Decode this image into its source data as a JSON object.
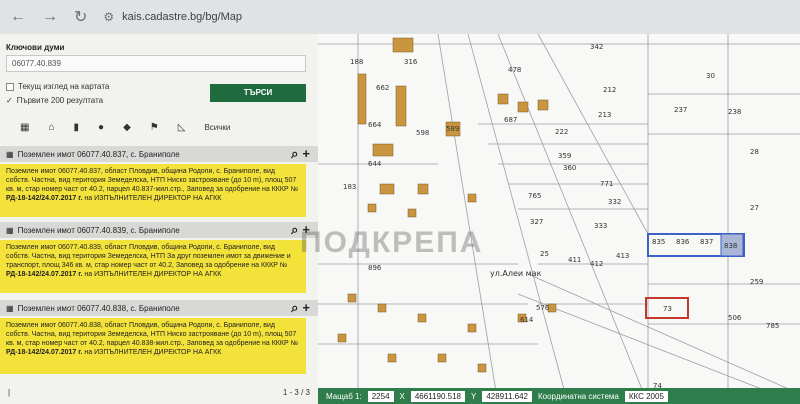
{
  "browser": {
    "back": "←",
    "forward": "→",
    "reload": "↻",
    "url": "kais.cadastre.bg/bg/Map"
  },
  "sidebar": {
    "keywords_label": "Ключови думи",
    "search_value": "06077.40.839",
    "current_view_label": "Текущ изглед на картата",
    "first200_label": "Първите 200 резултата",
    "search_button": "ТЪРСИ",
    "all_label": "Всички"
  },
  "results": [
    {
      "title": "Поземлен имот 06077.40.837, с. Браниполе",
      "line1": "Поземлен имот 06077.40.837, област Пловдив, община Родопи, с. Браниполе, вид собств. Частна, вид територия Земеделска, НТП Ниско застрояване (до 10 m), площ 507 кв. м, стар номер част от 40.2, парцел 40.837-жил.стр.,",
      "approval_prefix": "Заповед за одобрение на КККР №",
      "approval_num": "РД-18-142/24.07.2017 г.",
      "approval_suffix": "на ИЗПЪЛНИТЕЛЕН ДИРЕКТОР НА АГКК"
    },
    {
      "title": "Поземлен имот 06077.40.839, с. Браниполе",
      "line1": "Поземлен имот 06077.40.839, област Пловдив, община Родопи, с. Браниполе, вид собств. Частна, вид територия Земеделска, НТП За друг поземлен имот за движение и транспорт, площ 346 кв. м, стар номер част от 40.2,",
      "approval_prefix": "Заповед за одобрение на КККР №",
      "approval_num": "РД-18-142/24.07.2017 г.",
      "approval_suffix": "на ИЗПЪЛНИТЕЛЕН ДИРЕКТОР НА АГКК"
    },
    {
      "title": "Поземлен имот 06077.40.838, с. Браниполе",
      "line1": "Поземлен имот 06077.40.838, област Пловдив, община Родопи, с. Браниполе, вид собств. Частна, вид територия Земеделска, НТП Ниско застрояване (до 10 m), площ 507 кв. м, стар номер част от 40.2, парцел 40.838-жил.стр.,",
      "approval_prefix": "Заповед за одобрение на КККР №",
      "approval_num": "РД-18-142/24.07.2017 г.",
      "approval_suffix": "на ИЗПЪЛНИТЕЛЕН ДИРЕКТОР НА АГКК"
    }
  ],
  "pager": {
    "text": "1 - 3 / 3"
  },
  "map": {
    "parcel_labels": [
      "342",
      "478",
      "316",
      "188",
      "212",
      "662",
      "213",
      "664",
      "598",
      "222",
      "589",
      "359",
      "360",
      "765",
      "771",
      "332",
      "327",
      "183",
      "333",
      "644",
      "25",
      "411",
      "412",
      "413",
      "28",
      "27",
      "835",
      "836",
      "837",
      "838",
      "259",
      "30",
      "237",
      "238",
      "73",
      "506",
      "785",
      "614",
      "576",
      "74",
      "896",
      "687"
    ],
    "street_label": "ул.Алеи мак"
  },
  "watermark": "ПОДКРЕПА",
  "bottom": {
    "scale_label": "Мащаб 1:",
    "scale_value": "2254",
    "x_value": "4661190.518",
    "y_value": "428911.642",
    "crs_label": "Координатна система",
    "crs_value": "ККС 2005"
  },
  "colors": {
    "accent_green": "#1f6b3e",
    "result_yellow": "#f3e23a",
    "building": "#c9953f",
    "selected_blue": "#3b62c4",
    "selected_red": "#c0392b"
  }
}
